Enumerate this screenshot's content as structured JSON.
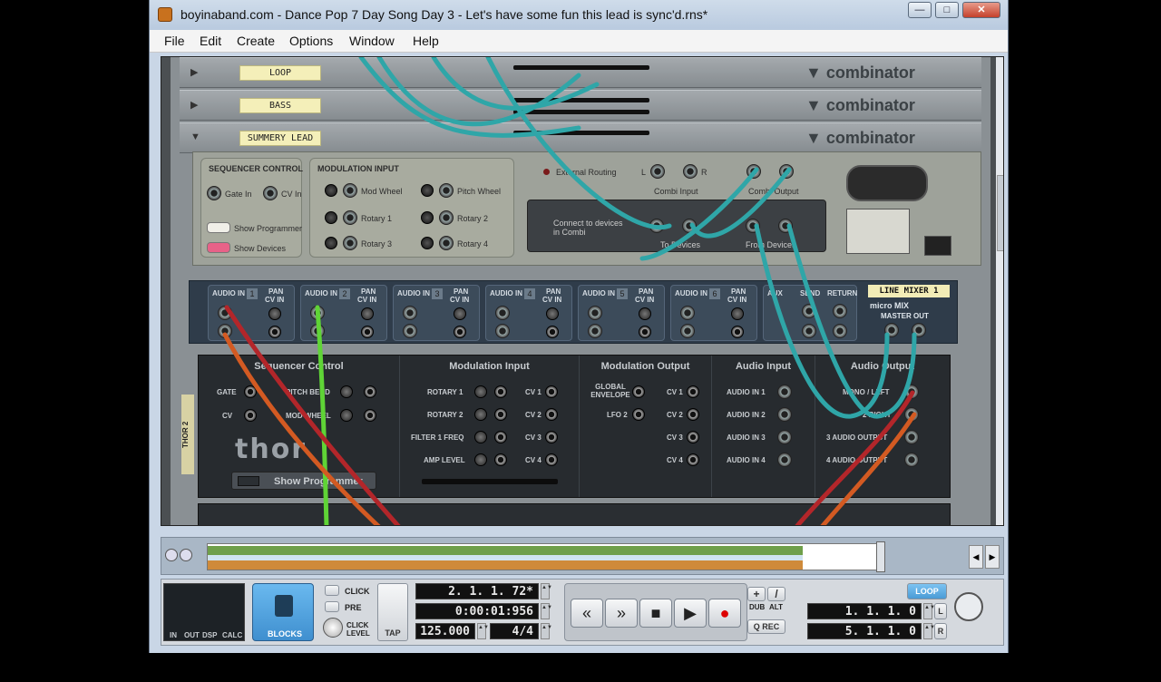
{
  "window": {
    "title": "boyinaband.com - Dance Pop 7 Day Song Day 3 - Let's have some fun this lead is sync'd.rns*",
    "controls": {
      "minimize": "—",
      "maximize": "□",
      "close": "✕"
    }
  },
  "menu": [
    "File",
    "Edit",
    "Create",
    "Options",
    "Window",
    "Help"
  ],
  "rack": {
    "combinators": [
      {
        "name": "LOOP",
        "brand": "combinator",
        "expanded": false
      },
      {
        "name": "BASS",
        "brand": "combinator",
        "expanded": false
      },
      {
        "name": "SUMMERY LEAD",
        "brand": "combinator",
        "expanded": true
      }
    ],
    "combi_panel": {
      "sequencer_control": {
        "title": "SEQUENCER CONTROL",
        "gate": "Gate In",
        "cv": "CV In"
      },
      "show_programmer": "Show Programmer",
      "show_devices": "Show Devices",
      "modulation_input": {
        "title": "MODULATION INPUT",
        "items": [
          "Mod Wheel",
          "Pitch Wheel",
          "Rotary 1",
          "Rotary 2",
          "Rotary 3",
          "Rotary 4"
        ]
      },
      "external_routing": "External Routing",
      "combi_input": "Combi Input",
      "combi_output": "Combi Output",
      "to_devices": "To Devices",
      "from_devices": "From Devices",
      "connect_text": "Connect to devices in Combi",
      "l": "L",
      "r": "R"
    },
    "line_mixer": {
      "label": "LINE MIXER 1",
      "brand": "micro MIX",
      "master_out": "MASTER OUT",
      "channels": [
        {
          "audio": "AUDIO IN",
          "num": "1",
          "pan": "PAN",
          "cv": "CV IN"
        },
        {
          "audio": "AUDIO IN",
          "num": "2",
          "pan": "PAN",
          "cv": "CV IN"
        },
        {
          "audio": "AUDIO IN",
          "num": "3",
          "pan": "PAN",
          "cv": "CV IN"
        },
        {
          "audio": "AUDIO IN",
          "num": "4",
          "pan": "PAN",
          "cv": "CV IN"
        },
        {
          "audio": "AUDIO IN",
          "num": "5",
          "pan": "PAN",
          "cv": "CV IN"
        },
        {
          "audio": "AUDIO IN",
          "num": "6",
          "pan": "PAN",
          "cv": "CV IN"
        }
      ],
      "aux": "AUX",
      "send": "SEND",
      "return": "RETURN"
    },
    "thor": {
      "tab": "THOR 2",
      "logo": "thor",
      "show_programmer": "Show Programmer",
      "sections": {
        "sequencer_control": {
          "title": "Sequencer Control",
          "gate": "GATE",
          "cv": "CV",
          "pitch_bend": "PITCH BEND",
          "mod_wheel": "MOD WHEEL"
        },
        "modulation_input": {
          "title": "Modulation Input",
          "rows": [
            "ROTARY 1",
            "ROTARY 2",
            "FILTER 1 FREQ",
            "AMP LEVEL"
          ],
          "cvs": [
            "CV 1",
            "CV 2",
            "CV 3",
            "CV 4"
          ]
        },
        "modulation_output": {
          "title": "Modulation Output",
          "rows": [
            "GLOBAL ENVELOPE",
            "LFO 2"
          ],
          "cvs": [
            "CV 1",
            "CV 2",
            "CV 3",
            "CV 4"
          ]
        },
        "audio_input": {
          "title": "Audio Input",
          "rows": [
            "AUDIO IN 1",
            "AUDIO IN 2",
            "AUDIO IN 3",
            "AUDIO IN 4"
          ]
        },
        "audio_output": {
          "title": "Audio Output",
          "rows": [
            "MONO / LEFT",
            "2 RIGHT",
            "3 AUDIO OUTPUT",
            "4 AUDIO OUTPUT"
          ]
        }
      }
    }
  },
  "transport": {
    "position": "2. 1. 1. 72*",
    "time": "0:00:01:956",
    "tempo": "125.000",
    "signature": "4/4",
    "blocks": "BLOCKS",
    "click": "CLICK",
    "pre": "PRE",
    "click_level": "CLICK LEVEL",
    "tap": "TAP",
    "meter_labels": [
      "IN",
      "OUT",
      "DSP",
      "CALC"
    ],
    "loop": "LOOP",
    "left_locator": "1. 1. 1.   0",
    "right_locator": "5. 1. 1.   0",
    "dub": "DUB",
    "alt": "ALT",
    "qrec": "Q REC",
    "l": "L",
    "r": "R"
  },
  "colors": {
    "cable_teal": "#2fa6a8",
    "cable_green": "#5fd436",
    "cable_orange": "#d35a22",
    "cable_red": "#b3262a"
  }
}
